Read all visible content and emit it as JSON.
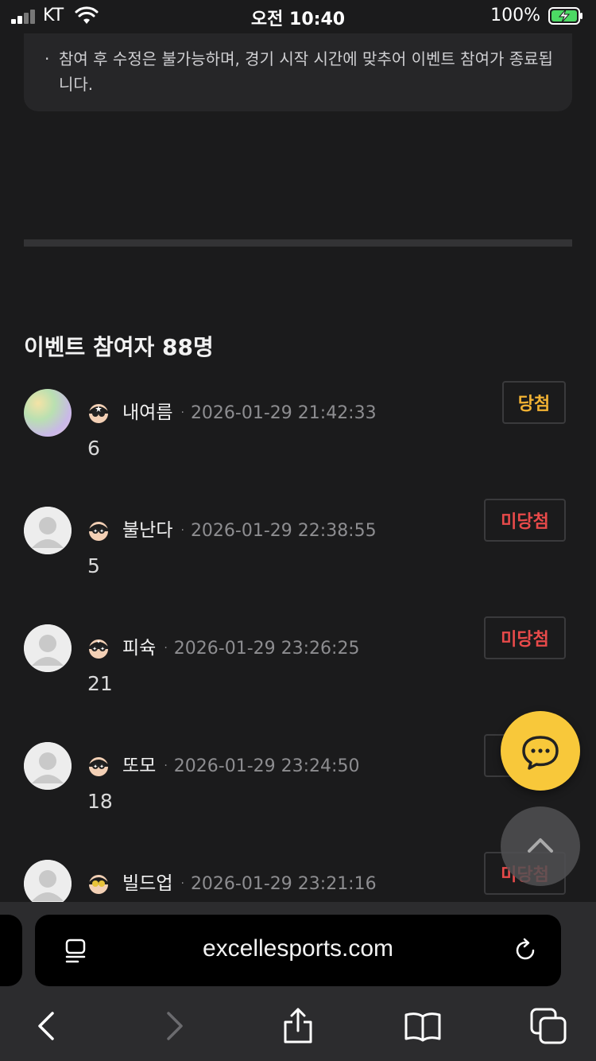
{
  "status_bar": {
    "carrier": "KT",
    "time": "오전 10:40",
    "battery": "100%"
  },
  "notice": {
    "bullet": "·",
    "text": "참여 후 수정은 불가능하며, 경기 시작 시간에 맞추어 이벤트 참여가 종료됩니다."
  },
  "section": {
    "title": "이벤트 참여자 88명"
  },
  "entries": [
    {
      "nickname": "내여름",
      "timestamp": "2026-01-29 21:42:33",
      "answer": "6",
      "result": "당첨",
      "result_type": "win",
      "avatar": "custom"
    },
    {
      "nickname": "불난다",
      "timestamp": "2026-01-29 22:38:55",
      "answer": "5",
      "result": "미당첨",
      "result_type": "lose",
      "avatar": "default"
    },
    {
      "nickname": "피슉",
      "timestamp": "2026-01-29 23:26:25",
      "answer": "21",
      "result": "미당첨",
      "result_type": "lose",
      "avatar": "default"
    },
    {
      "nickname": "또모",
      "timestamp": "2026-01-29 23:24:50",
      "answer": "18",
      "result": "미당첨",
      "result_type": "lose",
      "avatar": "default"
    },
    {
      "nickname": "빌드업",
      "timestamp": "2026-01-29 23:21:16",
      "answer": "",
      "result": "미당첨",
      "result_type": "lose",
      "avatar": "default"
    }
  ],
  "separator": "·",
  "browser": {
    "url": "excellesports.com"
  },
  "icons": {
    "chat": "chat-bubble-icon",
    "scroll_top": "chevron-up-icon",
    "reader": "reader-mode-icon",
    "reload": "reload-icon",
    "back": "chevron-left-icon",
    "forward": "chevron-right-icon",
    "share": "share-icon",
    "bookmarks": "book-icon",
    "tabs": "tabs-icon"
  },
  "colors": {
    "background": "#1b1b1c",
    "win": "#f2b233",
    "lose": "#e84a4a",
    "chat_fab": "#f8c83a"
  }
}
